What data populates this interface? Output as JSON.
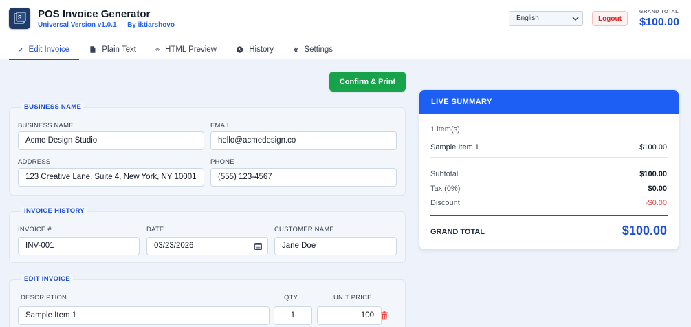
{
  "app": {
    "title": "POS Invoice Generator",
    "subtitle": "Universal Version v1.0.1 — By iktiarshovo",
    "logo_icon": "stacked-logo-icon"
  },
  "header": {
    "language": "English",
    "logout_label": "Logout",
    "grand_total_label": "GRAND TOTAL",
    "grand_total_value": "$100.00"
  },
  "tabs": [
    {
      "label": "Edit Invoice",
      "icon": "pencil-icon",
      "active": true
    },
    {
      "label": "Plain Text",
      "icon": "document-icon",
      "active": false
    },
    {
      "label": "HTML Preview",
      "icon": "code-icon",
      "active": false
    },
    {
      "label": "History",
      "icon": "clock-icon",
      "active": false
    },
    {
      "label": "Settings",
      "icon": "gear-icon",
      "active": false
    }
  ],
  "actions": {
    "confirm_label": "Confirm & Print"
  },
  "business": {
    "section_title": "BUSINESS NAME",
    "name_label": "BUSINESS NAME",
    "name_value": "Acme Design Studio",
    "email_label": "EMAIL",
    "email_value": "hello@acmedesign.co",
    "address_label": "ADDRESS",
    "address_value": "123 Creative Lane, Suite 4, New York, NY 10001",
    "phone_label": "PHONE",
    "phone_value": "(555) 123-4567"
  },
  "invoice": {
    "section_title": "INVOICE HISTORY",
    "number_label": "INVOICE #",
    "number_value": "INV-001",
    "date_label": "DATE",
    "date_value": "03/23/2026",
    "customer_label": "CUSTOMER NAME",
    "customer_value": "Jane Doe"
  },
  "items": {
    "section_title": "EDIT INVOICE",
    "desc_label": "DESCRIPTION",
    "qty_label": "QTY",
    "price_label": "UNIT PRICE",
    "rows": [
      {
        "description": "Sample Item 1",
        "qty": "1",
        "unit_price": "100"
      }
    ]
  },
  "summary": {
    "title": "LIVE SUMMARY",
    "item_count": "1 item(s)",
    "lines": [
      {
        "name": "Sample Item 1",
        "amount": "$100.00"
      }
    ],
    "subtotal_label": "Subtotal",
    "subtotal_value": "$100.00",
    "tax_label": "Tax (0%)",
    "tax_value": "$0.00",
    "discount_label": "Discount",
    "discount_value": "-$0.00",
    "grand_label": "GRAND TOTAL",
    "grand_value": "$100.00"
  },
  "colors": {
    "accent": "#1d4ed8",
    "summary_header": "#1d5ef5",
    "confirm": "#16a34a",
    "danger": "#dc2626"
  }
}
